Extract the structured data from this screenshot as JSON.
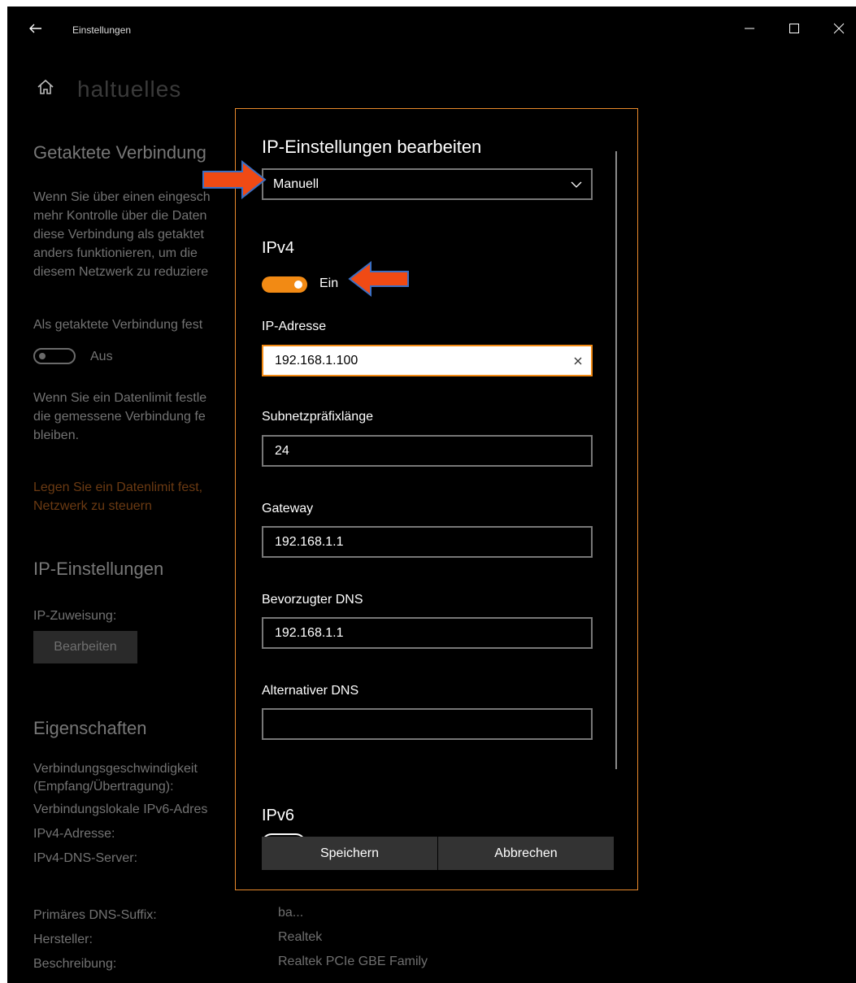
{
  "window": {
    "title": "Einstellungen"
  },
  "page": {
    "title": "haltuelles",
    "metered_section": {
      "title": "Getaktete Verbindung",
      "description_lines": [
        "Wenn Sie über einen eingesch",
        "mehr Kontrolle über die Daten",
        "diese Verbindung als getaktet",
        "anders funktionieren, um die",
        "diesem Netzwerk zu reduziere"
      ],
      "set_metered_label": "Als getaktete Verbindung fest",
      "toggle_state": "Aus",
      "limit_lines": [
        "Wenn Sie ein Datenlimit festle",
        "die gemessene Verbindung fe",
        "bleiben."
      ],
      "link_lines": [
        "Legen Sie ein Datenlimit fest,",
        "Netzwerk zu steuern"
      ]
    },
    "ip_section": {
      "title": "IP-Einstellungen",
      "assignment_label": "IP-Zuweisung:",
      "edit_button": "Bearbeiten"
    },
    "properties": {
      "title": "Eigenschaften",
      "rows": [
        {
          "label": "Verbindungsgeschwindigkeit",
          "value": ""
        },
        {
          "label": "(Empfang/Übertragung):",
          "value": ""
        },
        {
          "label": "Verbindungslokale IPv6-Adres",
          "value": ""
        },
        {
          "label": "IPv4-Adresse:",
          "value": ""
        },
        {
          "label": "IPv4-DNS-Server:",
          "value": ""
        },
        {
          "label": "Primäres DNS-Suffix:",
          "value": "ba..."
        },
        {
          "label": "Hersteller:",
          "value": "Realtek"
        },
        {
          "label": "Beschreibung:",
          "value": "Realtek PCIe GBE Family"
        }
      ]
    }
  },
  "dialog": {
    "title": "IP-Einstellungen bearbeiten",
    "mode_selected": "Manuell",
    "ipv4": {
      "heading": "IPv4",
      "toggle_label": "Ein",
      "ip_label": "IP-Adresse",
      "ip_value": "192.168.1.100",
      "subnet_label": "Subnetzpräfixlänge",
      "subnet_value": "24",
      "gateway_label": "Gateway",
      "gateway_value": "192.168.1.1",
      "dns_pref_label": "Bevorzugter DNS",
      "dns_pref_value": "192.168.1.1",
      "dns_alt_label": "Alternativer DNS",
      "dns_alt_value": ""
    },
    "ipv6": {
      "heading": "IPv6"
    },
    "save_button": "Speichern",
    "cancel_button": "Abbrechen"
  },
  "colors": {
    "accent": "#f28a14",
    "dialog_border": "#e98a2b",
    "arrow_fill": "#f04a14",
    "arrow_outline": "#3b6fc4"
  }
}
